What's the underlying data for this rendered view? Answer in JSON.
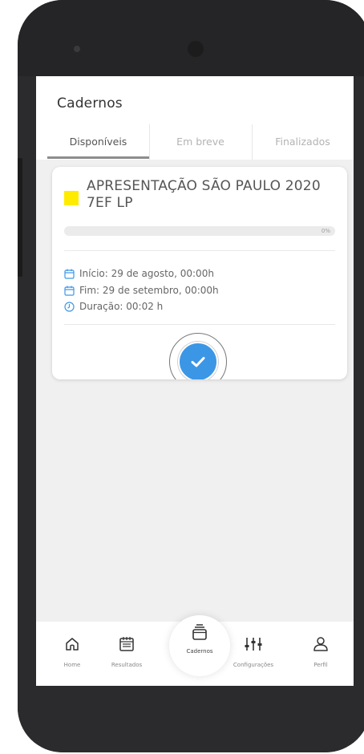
{
  "header": {
    "title": "Cadernos"
  },
  "tabs": [
    {
      "label": "Disponíveis",
      "active": true
    },
    {
      "label": "Em breve",
      "active": false
    },
    {
      "label": "Finalizados",
      "active": false
    }
  ],
  "card": {
    "color": "#ffeb00",
    "title_line1": "APRESENTAÇÃO SÃO PAULO 2020",
    "title_line2": "7EF LP",
    "progress": {
      "value": 0,
      "label": "0%"
    },
    "start_label": "Início: 29 de agosto, 00:00h",
    "end_label": "Fim: 29 de setembro, 00:00h",
    "duration_label": "Duração: 00:02 h",
    "action_icon": "check-circle-icon"
  },
  "bottom_nav": {
    "items": [
      {
        "label": "Home",
        "icon": "home-icon"
      },
      {
        "label": "Resultados",
        "icon": "calendar-icon"
      },
      {
        "label": "Cadernos",
        "icon": "notebooks-icon",
        "active": true
      },
      {
        "label": "Configurações",
        "icon": "sliders-icon"
      },
      {
        "label": "Perfil",
        "icon": "user-icon"
      }
    ]
  },
  "colors": {
    "accent": "#3c96e6",
    "highlight": "#ffeb00"
  }
}
